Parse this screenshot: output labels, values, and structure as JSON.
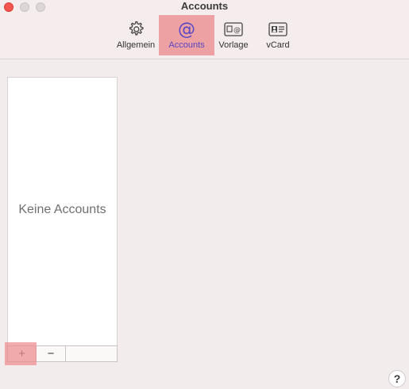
{
  "window": {
    "title": "Accounts"
  },
  "toolbar": {
    "items": [
      {
        "label": "Allgemein",
        "icon": "gear-icon",
        "selected": false
      },
      {
        "label": "Accounts",
        "icon": "at-sign-icon",
        "selected": true
      },
      {
        "label": "Vorlage",
        "icon": "template-icon",
        "selected": false
      },
      {
        "label": "vCard",
        "icon": "contact-card-icon",
        "selected": false
      }
    ]
  },
  "account_list": {
    "empty_label": "Keine Accounts",
    "add_label": "+",
    "remove_label": "−"
  },
  "help": {
    "label": "?"
  },
  "colors": {
    "accent_selected_bg": "#eda1a2",
    "accent_selected_text": "#5847c4",
    "close_button": "#f2564e",
    "window_bg": "#f2ecec"
  }
}
